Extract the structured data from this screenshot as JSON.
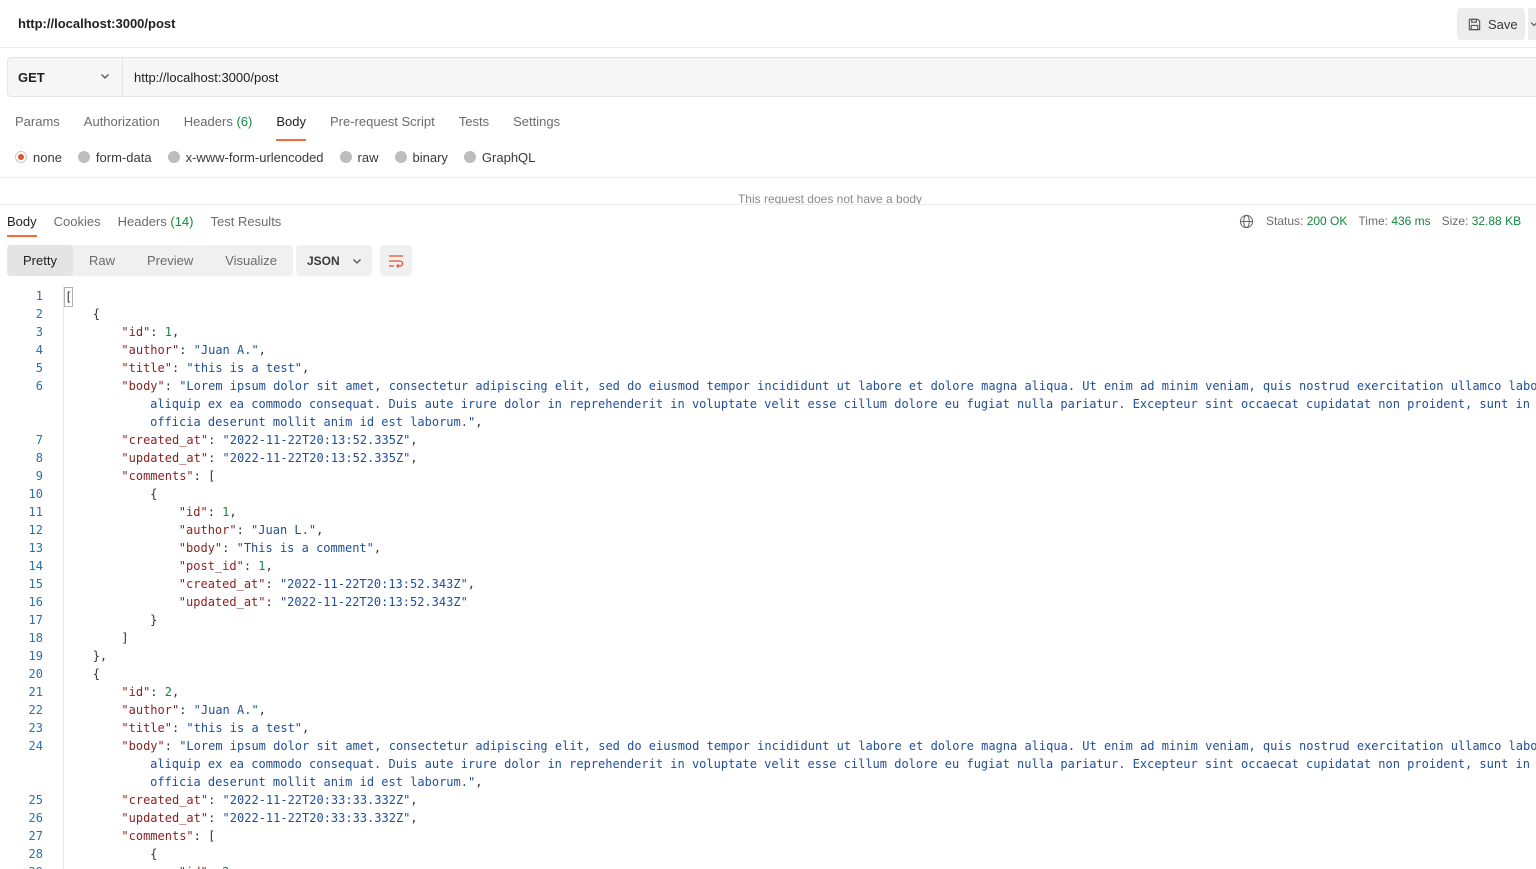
{
  "header": {
    "title": "http://localhost:3000/post",
    "save_label": "Save"
  },
  "request": {
    "method": "GET",
    "url": "http://localhost:3000/post"
  },
  "request_tabs": [
    {
      "label": "Params",
      "count": ""
    },
    {
      "label": "Authorization",
      "count": ""
    },
    {
      "label": "Headers",
      "count": "(6)"
    },
    {
      "label": "Body",
      "count": "",
      "active": true
    },
    {
      "label": "Pre-request Script",
      "count": ""
    },
    {
      "label": "Tests",
      "count": ""
    },
    {
      "label": "Settings",
      "count": ""
    }
  ],
  "body_types": [
    "none",
    "form-data",
    "x-www-form-urlencoded",
    "raw",
    "binary",
    "GraphQL"
  ],
  "no_body_text": "This request does not have a body",
  "response_tabs": [
    {
      "label": "Body",
      "count": "",
      "active": true
    },
    {
      "label": "Cookies",
      "count": ""
    },
    {
      "label": "Headers",
      "count": "(14)"
    },
    {
      "label": "Test Results",
      "count": ""
    }
  ],
  "status": {
    "status_label": "Status:",
    "status_value": "200 OK",
    "time_label": "Time:",
    "time_value": "436 ms",
    "size_label": "Size:",
    "size_value": "32.88 KB"
  },
  "view_modes": [
    "Pretty",
    "Raw",
    "Preview",
    "Visualize"
  ],
  "format": "JSON",
  "lore1": "Lorem ipsum dolor sit amet, consectetur adipiscing elit, sed do eiusmod tempor incididunt ut labore et dolore magna aliqua. Ut enim ad minim veniam, quis nostrud exercitation ullamco labor",
  "lore2": "aliquip ex ea commodo consequat. Duis aute irure dolor in reprehenderit in voluptate velit esse cillum dolore eu fugiat nulla pariatur. Excepteur sint occaecat cupidatat non proident, sunt in c",
  "lore3": "officia deserunt mollit anim id est laborum."
}
